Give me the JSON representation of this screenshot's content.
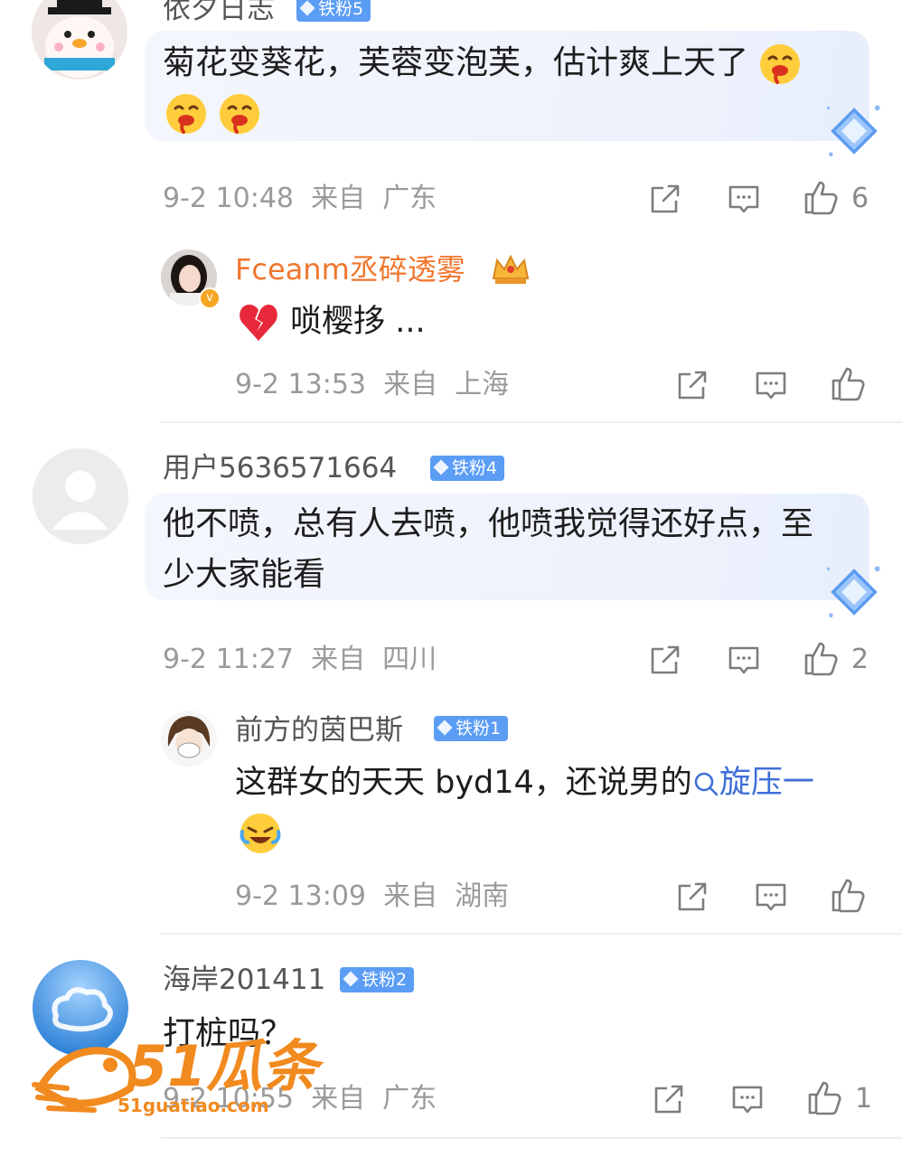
{
  "comments": [
    {
      "username": "依夕日志",
      "badge": "铁粉5",
      "text_line1": "菊花变葵花，芙蓉变泡芙，估计爽上天了",
      "time": "9-2 10:48",
      "from_label": "来自",
      "location": "广东",
      "likes": "6",
      "reply": {
        "username": "Fceanm丞碎透雾",
        "text": "唢樱拸 ...",
        "time": "9-2 13:53",
        "from_label": "来自",
        "location": "上海"
      }
    },
    {
      "username": "用户5636571664",
      "badge": "铁粉4",
      "text_line1": "他不喷，总有人去喷，他喷我觉得还好点，至",
      "text_line2": "少大家能看",
      "time": "9-2 11:27",
      "from_label": "来自",
      "location": "四川",
      "likes": "2",
      "reply": {
        "username": "前方的茵巴斯",
        "badge": "铁粉1",
        "text_prefix": "这群女的天天 byd14，还说男的",
        "search_link": "旋压一",
        "time": "9-2 13:09",
        "from_label": "来自",
        "location": "湖南"
      }
    },
    {
      "username": "海岸201411",
      "badge": "铁粉2",
      "text_line1": "打桩吗？",
      "time": "9-2 10:55",
      "from_label": "来自",
      "location": "广东",
      "likes": "1"
    }
  ],
  "watermark": {
    "brand": "51瓜条",
    "url": "51guatiao.com"
  },
  "colors": {
    "badge": "#5b9df5",
    "link": "#3e6fd8",
    "vip_name": "#f0762e",
    "meta": "#9a9a9a"
  },
  "icons": [
    "repost-icon",
    "comment-icon",
    "like-icon",
    "search-icon",
    "diamond-icon",
    "crown-icon",
    "broken-heart-emoji",
    "drooling-emoji",
    "laughing-emoji"
  ]
}
